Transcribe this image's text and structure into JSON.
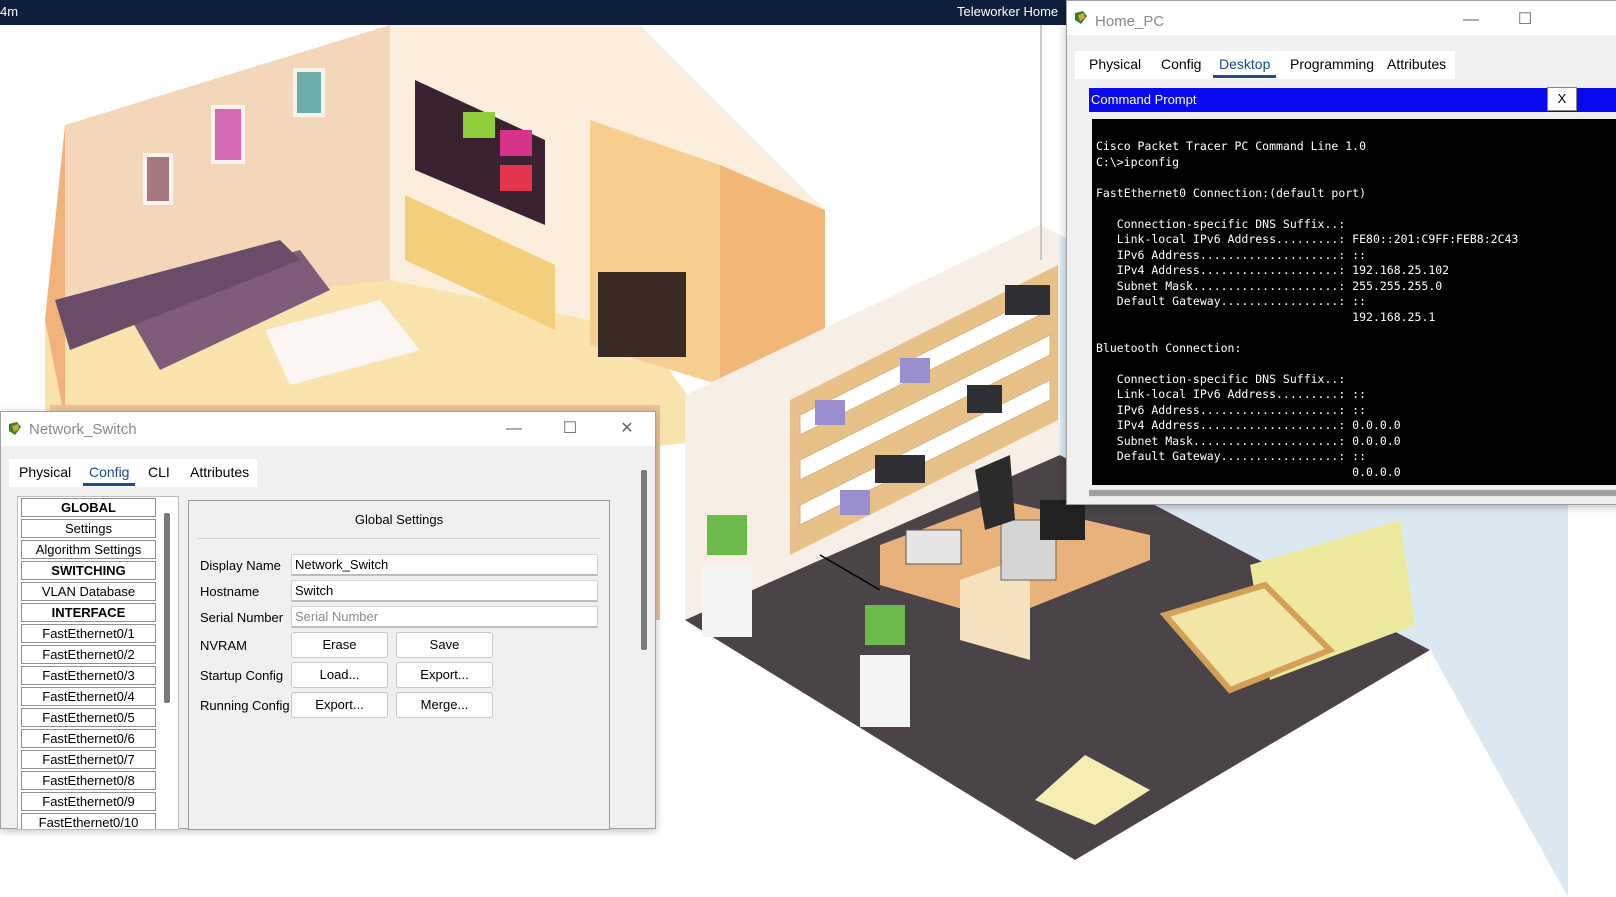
{
  "topbar": {
    "timer": "4m",
    "environment": "Teleworker Home",
    "env_icon": "compass-icon"
  },
  "switch_window": {
    "title": "Network_Switch",
    "tabs": [
      {
        "label": "Physical"
      },
      {
        "label": "Config"
      },
      {
        "label": "CLI"
      },
      {
        "label": "Attributes"
      }
    ],
    "active_tab": "Config",
    "left_list": [
      {
        "label": "GLOBAL",
        "header": true
      },
      {
        "label": "Settings"
      },
      {
        "label": "Algorithm Settings"
      },
      {
        "label": "SWITCHING",
        "header": true
      },
      {
        "label": "VLAN Database"
      },
      {
        "label": "INTERFACE",
        "header": true
      },
      {
        "label": "FastEthernet0/1"
      },
      {
        "label": "FastEthernet0/2"
      },
      {
        "label": "FastEthernet0/3"
      },
      {
        "label": "FastEthernet0/4"
      },
      {
        "label": "FastEthernet0/5"
      },
      {
        "label": "FastEthernet0/6"
      },
      {
        "label": "FastEthernet0/7"
      },
      {
        "label": "FastEthernet0/8"
      },
      {
        "label": "FastEthernet0/9"
      },
      {
        "label": "FastEthernet0/10"
      }
    ],
    "panel": {
      "heading": "Global Settings",
      "display_name_label": "Display Name",
      "display_name_value": "Network_Switch",
      "hostname_label": "Hostname",
      "hostname_value": "Switch",
      "serial_label": "Serial Number",
      "serial_placeholder": "Serial Number",
      "nvram_label": "NVRAM",
      "nvram_erase": "Erase",
      "nvram_save": "Save",
      "startup_label": "Startup Config",
      "startup_load": "Load...",
      "startup_export": "Export...",
      "running_label": "Running Config",
      "running_export": "Export...",
      "running_merge": "Merge..."
    }
  },
  "pc_window": {
    "title": "Home_PC",
    "tabs": [
      {
        "label": "Physical"
      },
      {
        "label": "Config"
      },
      {
        "label": "Desktop"
      },
      {
        "label": "Programming"
      },
      {
        "label": "Attributes"
      }
    ],
    "active_tab": "Desktop",
    "command_prompt_title": "Command Prompt",
    "close_label": "X",
    "terminal_lines": [
      "Cisco Packet Tracer PC Command Line 1.0",
      "C:\\>ipconfig",
      "",
      "FastEthernet0 Connection:(default port)",
      "",
      "   Connection-specific DNS Suffix..:",
      "   Link-local IPv6 Address.........: FE80::201:C9FF:FEB8:2C43",
      "   IPv6 Address....................: ::",
      "   IPv4 Address....................: 192.168.25.102",
      "   Subnet Mask.....................: 255.255.255.0",
      "   Default Gateway.................: ::",
      "                                     192.168.25.1",
      "",
      "Bluetooth Connection:",
      "",
      "   Connection-specific DNS Suffix..:",
      "   Link-local IPv6 Address.........: ::",
      "   IPv6 Address....................: ::",
      "   IPv4 Address....................: 0.0.0.0",
      "   Subnet Mask.....................: 0.0.0.0",
      "   Default Gateway.................: ::",
      "                                     0.0.0.0"
    ]
  },
  "window_controls": {
    "minimize": "—",
    "maximize": "☐",
    "close": "✕"
  }
}
